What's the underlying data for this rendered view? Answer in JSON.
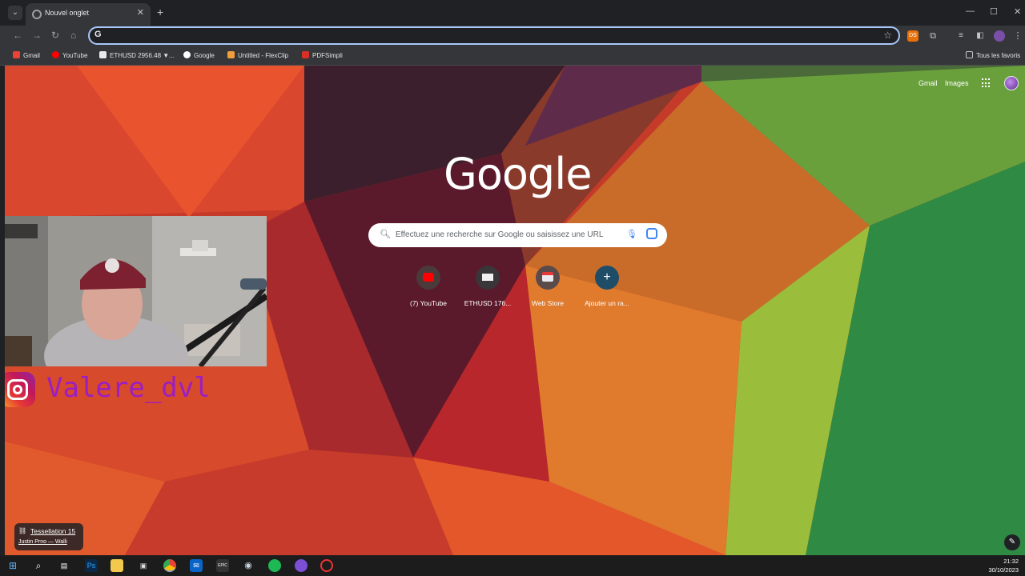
{
  "browser": {
    "tab_title": "Nouvel onglet",
    "bookmarks": [
      "Gmail",
      "YouTube",
      "ETHUSD 2956.48 ▼...",
      "Google",
      "Untitled - FlexClip",
      "PDFSimpli"
    ],
    "all_bookmarks": "Tous les favoris",
    "extension_badge": "DS"
  },
  "newtab": {
    "links": {
      "gmail": "Gmail",
      "images": "Images"
    },
    "logo": "Google",
    "search_placeholder": "Effectuez une recherche sur Google ou saisissez une URL",
    "shortcuts": [
      {
        "label": "(7) YouTube",
        "icon": "youtube-icon",
        "color": "#ff0000"
      },
      {
        "label": "ETHUSD 176...",
        "icon": "tradingview-icon",
        "color": "#131722"
      },
      {
        "label": "Web Store",
        "icon": "webstore-icon",
        "color": "#e53935"
      },
      {
        "label": "Ajouter un ra...",
        "icon": "plus-icon",
        "color": "#1a73e8"
      }
    ],
    "background_credit": {
      "title": "Tessellation 15",
      "subtitle": "Justin Prno — Walli"
    }
  },
  "overlay": {
    "instagram_handle": "Valere_dvl"
  },
  "taskbar": {
    "time": "21:32",
    "date": "30/10/2023",
    "apps": [
      "Ps",
      "EPIC"
    ]
  },
  "colors": {
    "accent": "#a8c7fa",
    "instagram_text": "#9b1ec4"
  }
}
